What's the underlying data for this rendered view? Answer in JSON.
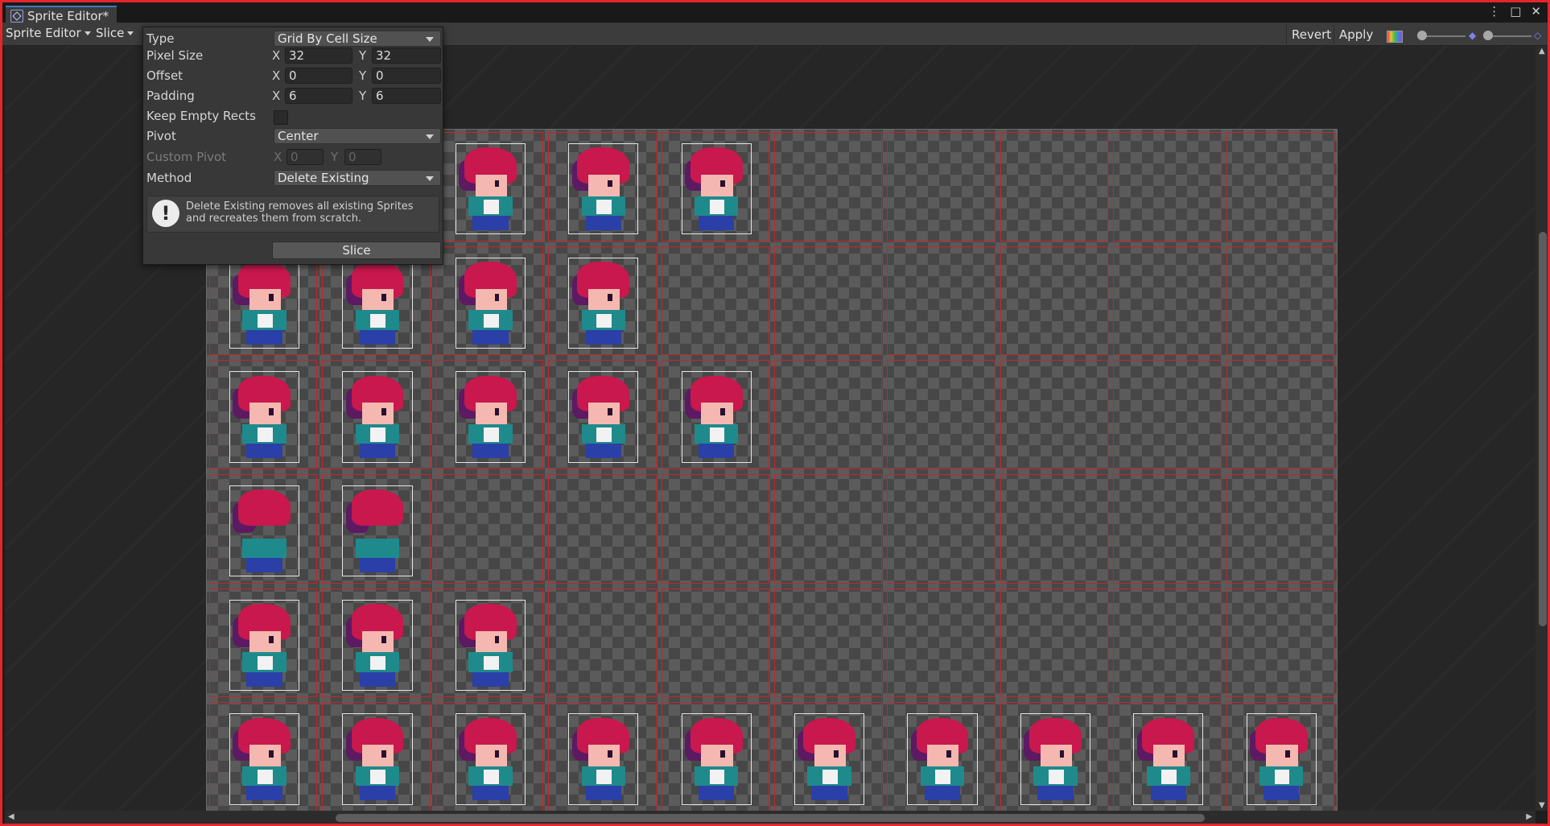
{
  "window": {
    "tab_title": "Sprite Editor*",
    "controls": [
      "⋮",
      "□",
      "✕"
    ]
  },
  "toolbar": {
    "mode_dropdown": "Sprite Editor",
    "slice_dropdown": "Slice",
    "revert_label": "Revert",
    "apply_label": "Apply"
  },
  "slice_popup": {
    "type_label": "Type",
    "type_value": "Grid By Cell Size",
    "pixel_size_label": "Pixel Size",
    "pixel_size_x": "32",
    "pixel_size_y": "32",
    "offset_label": "Offset",
    "offset_x": "0",
    "offset_y": "0",
    "padding_label": "Padding",
    "padding_x": "6",
    "padding_y": "6",
    "keep_empty_label": "Keep Empty Rects",
    "keep_empty_checked": false,
    "pivot_label": "Pivot",
    "pivot_value": "Center",
    "custom_pivot_label": "Custom Pivot",
    "custom_pivot_x": "0",
    "custom_pivot_y": "0",
    "method_label": "Method",
    "method_value": "Delete Existing",
    "help_text": "Delete Existing removes all existing Sprites and recreates them from scratch.",
    "slice_button": "Slice",
    "axis_x": "X",
    "axis_y": "Y"
  },
  "sprite_sheet": {
    "columns": 10,
    "rows": 6,
    "row_sprite_counts": [
      5,
      4,
      5,
      2,
      3,
      10
    ],
    "cell_border_color": "#c4262b",
    "sprite_rect_color": "#e6e6e6"
  },
  "colors": {
    "frame_border": "#e3262b",
    "hair": "#c8184d",
    "skin": "#f4b8b0",
    "shirt": "#1f8a8c",
    "pants": "#2a3fa8"
  }
}
